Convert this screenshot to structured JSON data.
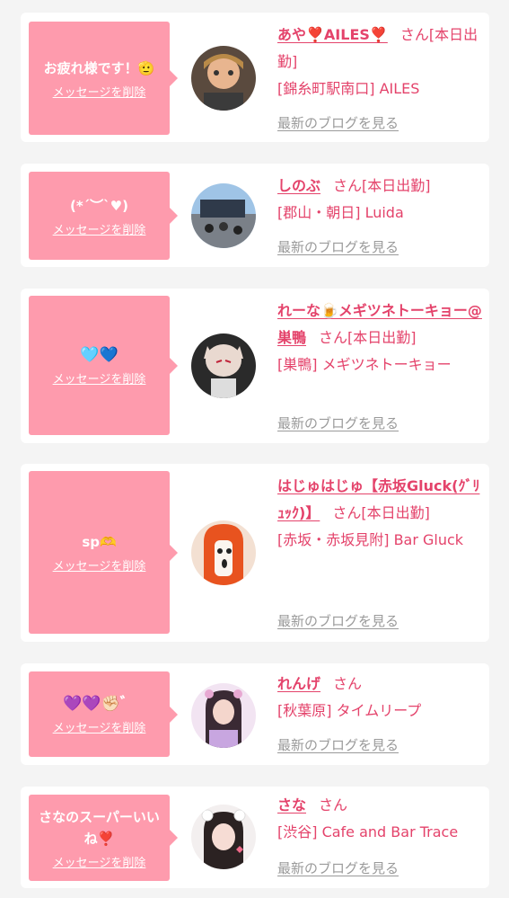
{
  "honorific": "さん",
  "delete_label": "メッセージを削除",
  "blog_label": "最新のブログを見る",
  "colors": {
    "bubble": "#fe9bad",
    "text": "#e4436b",
    "muted": "#9a9a9a",
    "page_bg": "#f4f4f4"
  },
  "messages": [
    {
      "message": "お疲れ様です！🫡",
      "name": "あや❣️AILES❣️",
      "attendance": "[本日出勤]",
      "shop": "[錦糸町駅南口] AILES",
      "avatar_icon": "avatar-icon"
    },
    {
      "message": "(*´︶`♥)",
      "name": "しのぶ",
      "attendance": "[本日出勤]",
      "shop": "[郡山・朝日] Luida",
      "avatar_icon": "avatar-icon"
    },
    {
      "message": "🩵💙",
      "name": "れーな🍺メギツネトーキョー@巣鴨",
      "attendance": "[本日出勤]",
      "shop": "[巣鴨] メギツネトーキョー",
      "avatar_icon": "avatar-icon"
    },
    {
      "message": "sp🫶",
      "name": "はじゅはじゅ【赤坂Gluck(ｸﾞﾘｭｯｸ)】",
      "attendance": "[本日出勤]",
      "shop": "[赤坂・赤坂見附] Bar Gluck",
      "avatar_icon": "avatar-icon"
    },
    {
      "message": "💜💜✊🏻゛",
      "name": "れんげ",
      "attendance": "",
      "shop": "[秋葉原] タイムリープ",
      "avatar_icon": "avatar-icon"
    },
    {
      "message": "さなのスーパーいいね❣️",
      "name": "さな",
      "attendance": "",
      "shop": "[渋谷] Cafe and Bar Trace",
      "avatar_icon": "avatar-icon"
    }
  ]
}
